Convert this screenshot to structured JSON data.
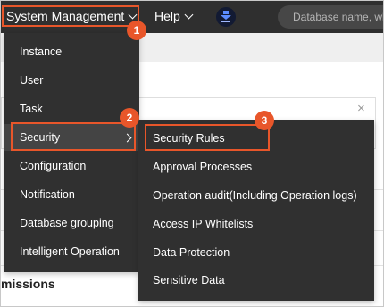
{
  "topbar": {
    "system_management": "System Management",
    "help": "Help",
    "search_placeholder": "Database name, wh"
  },
  "menu": {
    "items": [
      "Instance",
      "User",
      "Task",
      "Security",
      "Configuration",
      "Notification",
      "Database grouping",
      "Intelligent Operation"
    ],
    "active_index": 3
  },
  "submenu": {
    "items": [
      "Security Rules",
      "Approval Processes",
      "Operation audit(Including Operation logs)",
      "Access IP Whitelists",
      "Data Protection",
      "Sensitive Data"
    ]
  },
  "background": {
    "partial_text": "missions"
  },
  "badges": {
    "b1": "1",
    "b2": "2",
    "b3": "3"
  },
  "colors": {
    "topbar": "#2f2f2f",
    "menu": "#303030",
    "highlight": "#e8562a"
  }
}
